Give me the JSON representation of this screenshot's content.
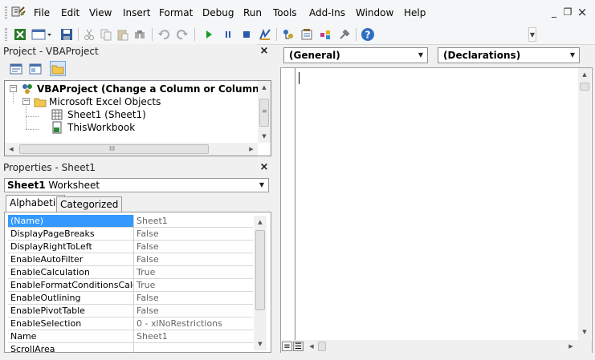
{
  "menu": {
    "items": [
      "File",
      "Edit",
      "View",
      "Insert",
      "Format",
      "Debug",
      "Run",
      "Tools",
      "Add-Ins",
      "Window",
      "Help"
    ],
    "window_controls": {
      "minimize": "_",
      "restore": "❐",
      "close": "×"
    }
  },
  "toolbar": {
    "icons": [
      "excel-view-icon",
      "insert-userform-icon",
      "save-icon",
      "cut-icon",
      "copy-icon",
      "paste-icon",
      "find-icon",
      "undo-icon",
      "redo-icon",
      "run-icon",
      "break-icon",
      "reset-icon",
      "design-mode-icon",
      "project-explorer-icon",
      "properties-icon",
      "object-browser-icon",
      "toolbox-icon",
      "help-icon"
    ]
  },
  "project_pane": {
    "title": "Project - VBAProject",
    "close": "×",
    "tree": {
      "root": "VBAProject (Change a Column or Columns to valu",
      "folder": "Microsoft Excel Objects",
      "items": [
        "Sheet1 (Sheet1)",
        "ThisWorkbook"
      ]
    },
    "hscroll_grip": "III"
  },
  "properties_pane": {
    "title": "Properties - Sheet1",
    "close": "×",
    "object_name": "Sheet1",
    "object_type": "Worksheet",
    "tabs": [
      "Alphabetic",
      "Categorized"
    ],
    "rows": [
      {
        "name": "(Name)",
        "value": "Sheet1"
      },
      {
        "name": "DisplayPageBreaks",
        "value": "False"
      },
      {
        "name": "DisplayRightToLeft",
        "value": "False"
      },
      {
        "name": "EnableAutoFilter",
        "value": "False"
      },
      {
        "name": "EnableCalculation",
        "value": "True"
      },
      {
        "name": "EnableFormatConditionsCalculat",
        "value": "True"
      },
      {
        "name": "EnableOutlining",
        "value": "False"
      },
      {
        "name": "EnablePivotTable",
        "value": "False"
      },
      {
        "name": "EnableSelection",
        "value": "0 - xlNoRestrictions"
      },
      {
        "name": "Name",
        "value": "Sheet1"
      },
      {
        "name": "ScrollArea",
        "value": ""
      }
    ]
  },
  "code_window": {
    "object_combo": "(General)",
    "procedure_combo": "(Declarations)"
  },
  "colors": {
    "selection": "#3399ff",
    "chrome": "#f0f0f0",
    "border": "#828790"
  }
}
